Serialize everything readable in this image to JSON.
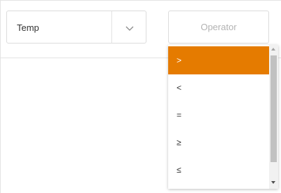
{
  "field_select": {
    "value": "Temp",
    "toggle_icon": "chevron-down-icon"
  },
  "operator_select": {
    "placeholder": "Operator"
  },
  "operator_dropdown": {
    "options": [
      ">",
      "<",
      "=",
      "≥",
      "≤"
    ],
    "highlighted_index": 0,
    "highlight_color": "#e57b00"
  }
}
